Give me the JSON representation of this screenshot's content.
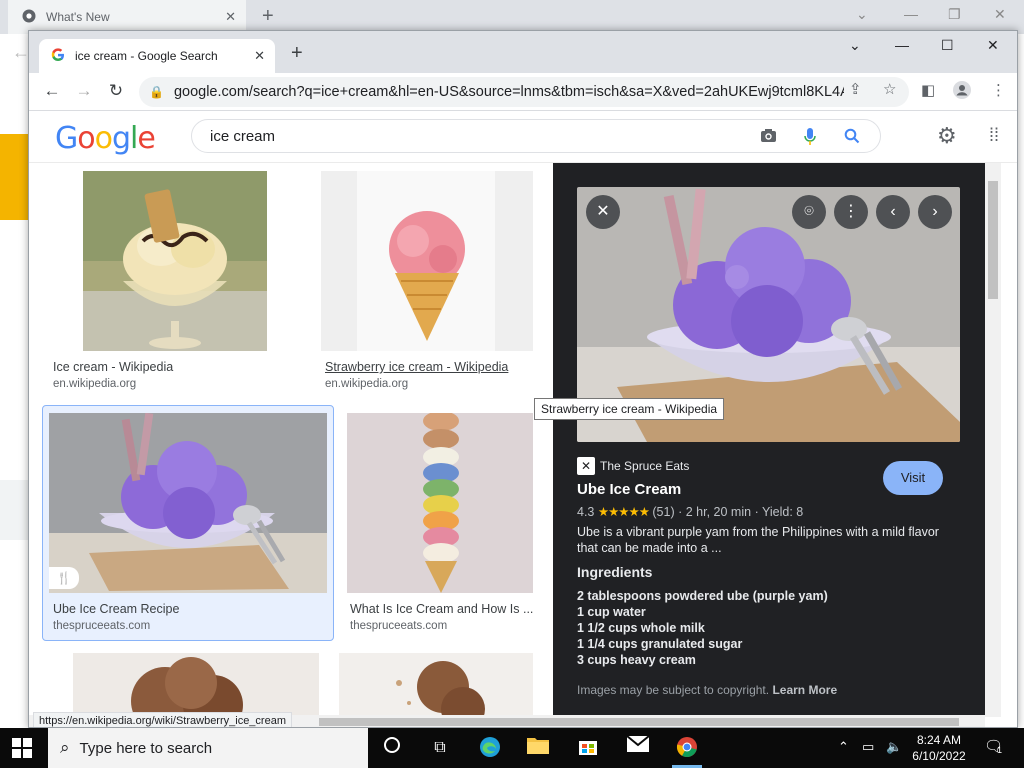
{
  "bg_window": {
    "tab_title": "What's New"
  },
  "window": {
    "tab_title": "ice cream - Google Search",
    "url": "google.com/search?q=ice+cream&hl=en-US&source=lnms&tbm=isch&sa=X&ved=2ahUKEwj9tcml8KL4A..."
  },
  "google": {
    "logo": "Google",
    "query": "ice cream"
  },
  "results": [
    {
      "title": "Ice cream - Wikipedia",
      "source": "en.wikipedia.org"
    },
    {
      "title": "Strawberry ice cream - Wikipedia",
      "source": "en.wikipedia.org"
    },
    {
      "title": "Ube Ice Cream Recipe",
      "source": "thespruceeats.com"
    },
    {
      "title": "What Is Ice Cream and How Is ...",
      "source": "thespruceeats.com"
    }
  ],
  "tooltip": "Strawberry ice cream - Wikipedia",
  "panel": {
    "site": "The Spruce Eats",
    "visit_label": "Visit",
    "title": "Ube Ice Cream",
    "rating": "4.3",
    "stars": "★★★★★",
    "reviews": "(51)",
    "time": "2 hr, 20 min",
    "yield": "Yield: 8",
    "description": "Ube is a vibrant purple yam from the Philippines with a mild flavor that can be made into a ...",
    "ingredients_heading": "Ingredients",
    "ingredients": [
      "2 tablespoons powdered ube (purple yam)",
      "1 cup water",
      "1 1/2 cups whole milk",
      "1 1/4 cups granulated sugar",
      "3 cups heavy cream"
    ],
    "copyright": "Images may be subject to copyright.",
    "learn_more": "Learn More"
  },
  "status_url": "https://en.wikipedia.org/wiki/Strawberry_ice_cream",
  "taskbar": {
    "search_placeholder": "Type here to search",
    "time": "8:24 AM",
    "date": "6/10/2022",
    "notification_count": "1"
  },
  "colors": {
    "accent_blue": "#8ab4f8",
    "panel_bg": "#202124",
    "ube_purple": "#8a6fd8"
  }
}
